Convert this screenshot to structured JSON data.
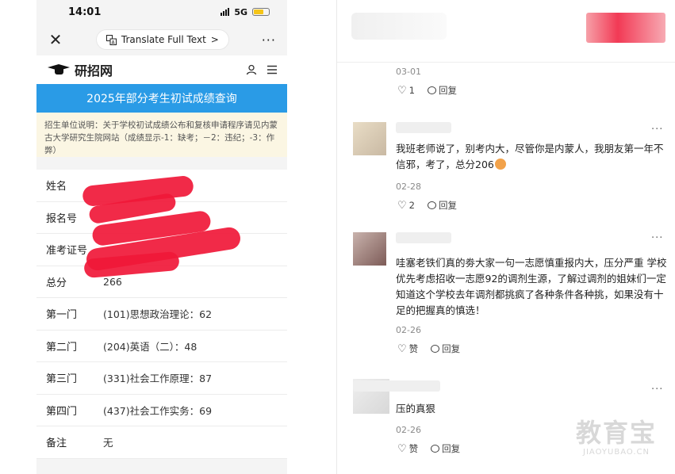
{
  "phone": {
    "time": "14:01",
    "network": "5G",
    "translate_label": "Translate Full Text",
    "translate_chevron": ">",
    "more": "···",
    "close": "✕",
    "site_name": "研招网",
    "banner_title": "2025年部分考生初试成绩查询",
    "notice": "招生单位说明：关于学校初试成绩公布和复核申请程序请见内蒙古大学研究生院网站（成绩显示-1：缺考；－2：违纪；-3：作弊）",
    "rows": [
      {
        "label": "姓名",
        "value": ""
      },
      {
        "label": "报名号",
        "value": ""
      },
      {
        "label": "准考证号",
        "value": ""
      },
      {
        "label": "总分",
        "value": "266"
      },
      {
        "label": "第一门",
        "value": "(101)思想政治理论：62"
      },
      {
        "label": "第二门",
        "value": "(204)英语（二）：48"
      },
      {
        "label": "第三门",
        "value": "(331)社会工作原理：87"
      },
      {
        "label": "第四门",
        "value": "(437)社会工作实务：69"
      },
      {
        "label": "备注",
        "value": "无"
      }
    ],
    "icons": {
      "user": "user-icon",
      "menu": "menu-icon",
      "translate": "translate-icon"
    }
  },
  "comments": [
    {
      "text": "",
      "date": "03-01",
      "likes": "1",
      "reply": "回复"
    },
    {
      "text": "我班老师说了，别考内大，尽管你是内蒙人，我朋友第一年不信邪，考了，总分206",
      "date": "02-28",
      "likes": "2",
      "reply": "回复"
    },
    {
      "text": "哇塞老铁们真的劵大家一句一志愿慎重报内大，压分严重 学校优先考虑招收一志愿92的调剂生源，了解过调剂的姐妹们一定知道这个学校去年调剂都挑疯了各种条件各种挑，如果没有十足的把握真的慎选！",
      "date": "02-26",
      "likes": "赞",
      "reply": "回复"
    },
    {
      "text": "压的真狠",
      "date": "02-26",
      "likes": "赞",
      "reply": "回复"
    }
  ],
  "more_menu": "···",
  "watermark": {
    "cn": "教育宝",
    "en": "JIAOYUBAO.CN"
  },
  "colors": {
    "banner": "#2a9be6",
    "notice_bg": "#fbf6e3",
    "redaction": "#f01838"
  }
}
